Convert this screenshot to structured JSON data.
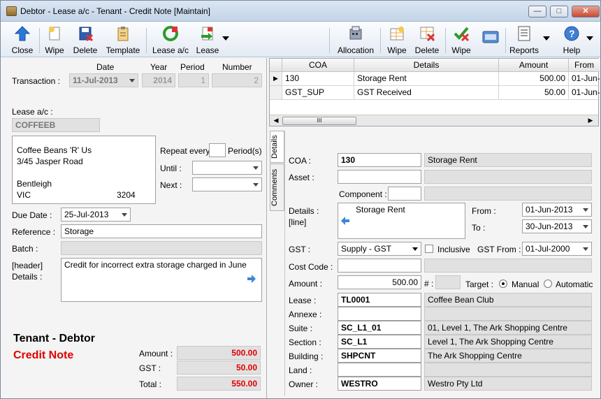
{
  "window": {
    "title": "Debtor - Lease a/c - Tenant - Credit Note [Maintain]",
    "min": "—",
    "max": "□",
    "close": "✕"
  },
  "toolbar": {
    "close": "Close",
    "wipe": "Wipe",
    "delete": "Delete",
    "template": "Template",
    "lease_ac": "Lease a/c",
    "lease": "Lease",
    "allocation": "Allocation",
    "wipe2": "Wipe",
    "delete2": "Delete",
    "wipe3": "Wipe",
    "reports": "Reports",
    "help": "Help"
  },
  "header": {
    "col_date": "Date",
    "col_year": "Year",
    "col_period": "Period",
    "col_number": "Number",
    "transaction_label": "Transaction :",
    "date": "11-Jul-2013",
    "year": "2014",
    "period": "1",
    "number": "2"
  },
  "lease": {
    "label": "Lease a/c :",
    "code": "COFFEEB",
    "address": [
      "Coffee Beans 'R' Us",
      "3/45 Jasper Road",
      "",
      "Bentleigh"
    ],
    "state": "VIC",
    "postcode": "3204",
    "repeat_label": "Repeat every",
    "repeat_value": "",
    "period_label": "Period(s)",
    "until_label": "Until :",
    "next_label": "Next :",
    "until": "",
    "next": ""
  },
  "form": {
    "due_label": "Due Date :",
    "due_date": "25-Jul-2013",
    "ref_label": "Reference :",
    "reference": "Storage",
    "batch_label": "Batch :",
    "batch": "",
    "hdr_label1": "[header]",
    "hdr_label2": "Details :",
    "header_details": "Credit for incorrect extra storage charged in June"
  },
  "summary": {
    "title1": "Tenant - Debtor",
    "title2": "Credit Note",
    "amount_label": "Amount :",
    "amount": "500.00",
    "gst_label": "GST :",
    "gst": "50.00",
    "total_label": "Total :",
    "total": "550.00"
  },
  "grid": {
    "headers": [
      "COA",
      "Details",
      "Amount",
      "From"
    ],
    "rows": [
      {
        "coa": "130",
        "details": "Storage Rent",
        "amount": "500.00",
        "from": "01-Jun-"
      },
      {
        "coa": "GST_SUP",
        "details": "GST Received",
        "amount": "50.00",
        "from": "01-Jun-"
      }
    ],
    "scroll_thumb": "III"
  },
  "tabs": {
    "details": "Details",
    "comments": "Comments"
  },
  "line": {
    "coa_label": "COA :",
    "coa": "130",
    "coa_desc": "Storage Rent",
    "asset_label": "Asset :",
    "asset": "",
    "asset_desc": "",
    "component_label": "Component :",
    "component": "",
    "component_desc": "",
    "details_label1": "Details :",
    "details_label2": "[line]",
    "details": "Storage Rent",
    "from_label": "From :",
    "from": "01-Jun-2013",
    "to_label": "To :",
    "to": "30-Jun-2013",
    "gst_label": "GST :",
    "gst": "Supply - GST",
    "inclusive_label": "Inclusive",
    "gst_from_label": "GST From :",
    "gst_from": "01-Jul-2000",
    "cost_code_label": "Cost Code :",
    "cost_code": "",
    "cost_code_desc": "",
    "amount_label": "Amount :",
    "amount": "500.00",
    "hash_label": "# :",
    "hash": "",
    "target_label": "Target :",
    "target_manual": "Manual",
    "target_auto": "Automatic",
    "lease_label": "Lease :",
    "lease": "TL0001",
    "lease_desc": "Coffee Bean Club",
    "annexe_label": "Annexe :",
    "annexe": "",
    "annexe_desc": "",
    "suite_label": "Suite :",
    "suite": "SC_L1_01",
    "suite_desc": "01, Level 1, The Ark Shopping Centre",
    "section_label": "Section :",
    "section": "SC_L1",
    "section_desc": "Level 1, The Ark Shopping Centre",
    "building_label": "Building :",
    "building": "SHPCNT",
    "building_desc": "The Ark Shopping Centre",
    "land_label": "Land :",
    "land": "",
    "land_desc": "",
    "owner_label": "Owner :",
    "owner": "WESTRO",
    "owner_desc": "Westro Pty Ltd"
  },
  "colors": {
    "accent_red": "#e00000",
    "toolbar_blue": "#2b6cc4"
  }
}
